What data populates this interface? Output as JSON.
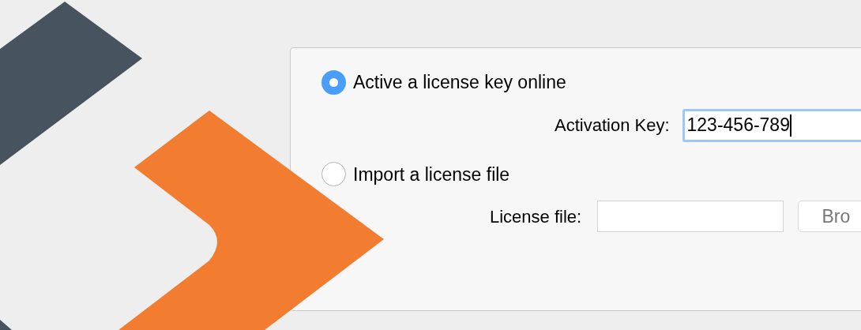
{
  "options": [
    {
      "label": "Active a license key online",
      "selected": true,
      "field": {
        "label": "Activation Key:",
        "value": "123-456-789",
        "focused": true
      }
    },
    {
      "label": "Import a license file",
      "selected": false,
      "field": {
        "label": "License file:",
        "focused": false,
        "button": "Bro"
      }
    }
  ]
}
